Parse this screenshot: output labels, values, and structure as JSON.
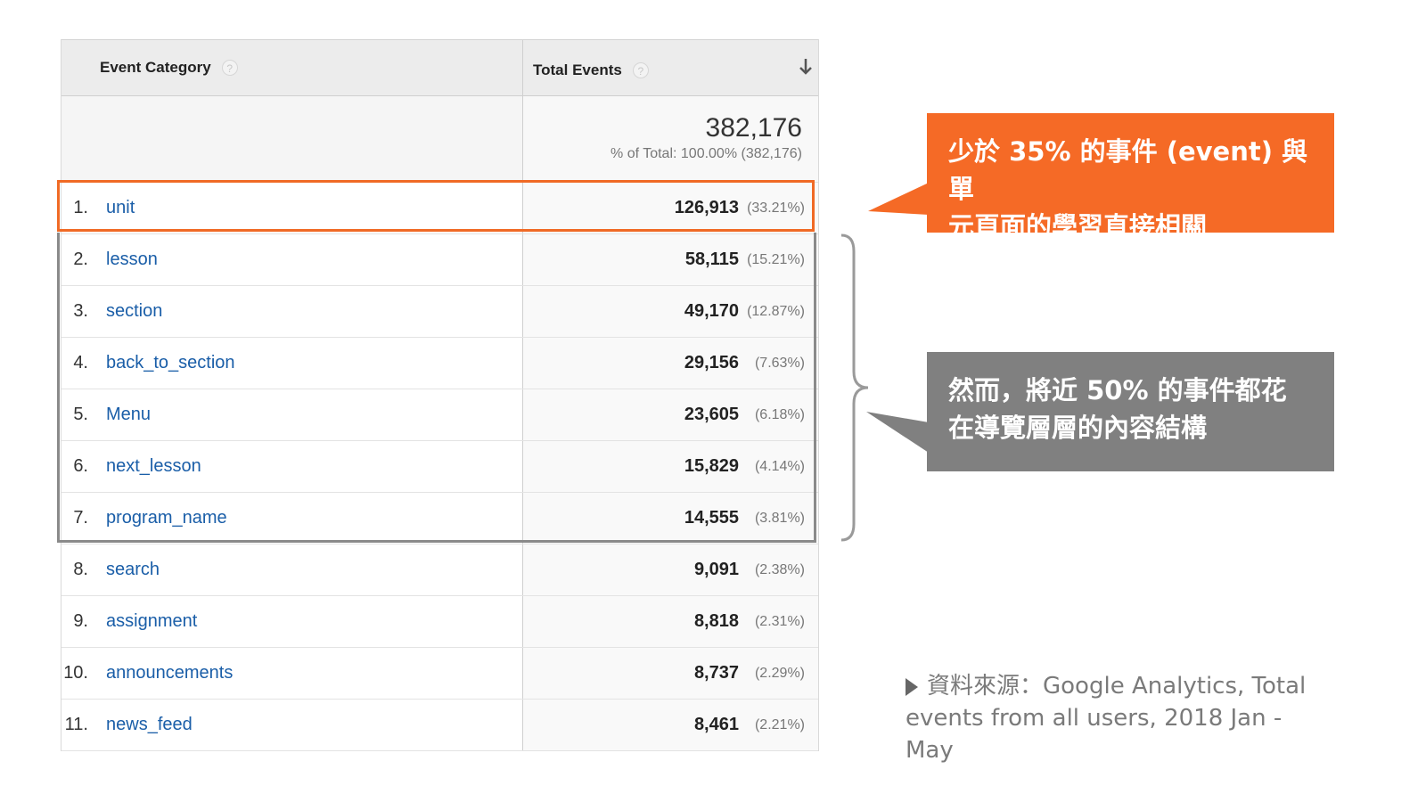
{
  "table": {
    "col_category": "Event Category",
    "col_total": "Total Events",
    "help_glyph": "?",
    "total_value": "382,176",
    "total_pct": "% of Total: 100.00% (382,176)",
    "rows": [
      {
        "index": "1.",
        "category": "unit",
        "value": "126,913",
        "pct": "(33.21%)"
      },
      {
        "index": "2.",
        "category": "lesson",
        "value": "58,115",
        "pct": "(15.21%)"
      },
      {
        "index": "3.",
        "category": "section",
        "value": "49,170",
        "pct": "(12.87%)"
      },
      {
        "index": "4.",
        "category": "back_to_section",
        "value": "29,156",
        "pct": "(7.63%)"
      },
      {
        "index": "5.",
        "category": "Menu",
        "value": "23,605",
        "pct": "(6.18%)"
      },
      {
        "index": "6.",
        "category": "next_lesson",
        "value": "15,829",
        "pct": "(4.14%)"
      },
      {
        "index": "7.",
        "category": "program_name",
        "value": "14,555",
        "pct": "(3.81%)"
      },
      {
        "index": "8.",
        "category": "search",
        "value": "9,091",
        "pct": "(2.38%)"
      },
      {
        "index": "9.",
        "category": "assignment",
        "value": "8,818",
        "pct": "(2.31%)"
      },
      {
        "index": "10.",
        "category": "announcements",
        "value": "8,737",
        "pct": "(2.29%)"
      },
      {
        "index": "11.",
        "category": "news_feed",
        "value": "8,461",
        "pct": "(2.21%)"
      }
    ]
  },
  "callouts": {
    "orange_line1": "少於 35% 的事件 (event) 與單",
    "orange_line2": "元頁面的學習直接相關",
    "gray_line1": "然而，將近 50% 的事件都花",
    "gray_line2": "在導覽層層的內容結構"
  },
  "source": {
    "line1": "資料來源：Google Analytics, Total",
    "line2": "events from all users, 2018 Jan - May"
  },
  "colors": {
    "accent_orange": "#f56a26",
    "callout_gray": "#808080",
    "link_blue": "#1a5ea8"
  },
  "icons": [
    "help-icon",
    "sort-descending-icon",
    "source-triangle-icon"
  ]
}
